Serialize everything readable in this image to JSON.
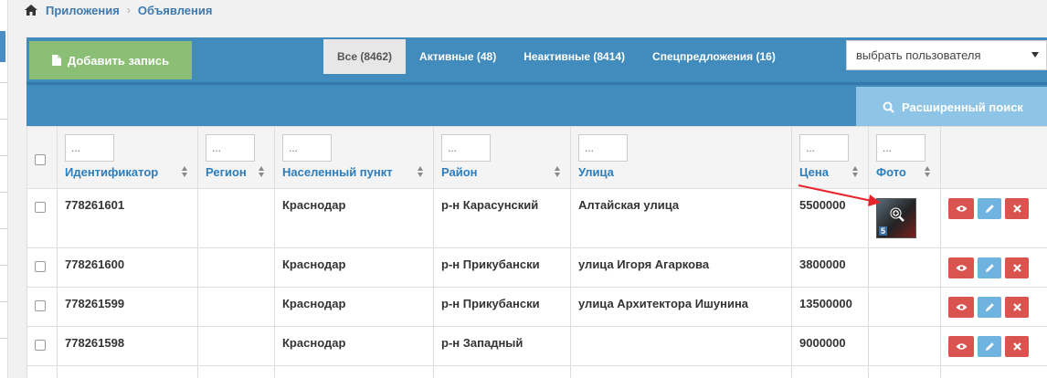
{
  "breadcrumb": {
    "home_icon": "home-icon",
    "items": [
      "Приложения",
      "Объявления"
    ]
  },
  "toolbar": {
    "add_button": "Добавить запись",
    "tabs": [
      {
        "label": "Все (8462)",
        "active": true
      },
      {
        "label": "Активные (48)",
        "active": false
      },
      {
        "label": "Неактивные (8414)",
        "active": false
      },
      {
        "label": "Спецпредложения (16)",
        "active": false
      }
    ],
    "user_select": {
      "value": "выбрать пользователя"
    }
  },
  "search": {
    "button": "Расширенный поиск"
  },
  "table": {
    "filter_placeholder": "...",
    "columns": [
      "Идентификатор",
      "Регион",
      "Населенный пункт",
      "Район",
      "Улица",
      "Цена",
      "Фото"
    ],
    "rows": [
      {
        "id": "778261601",
        "region": "",
        "city": "Краснодар",
        "district": "р-н Карасунский",
        "street": "Алтайская улица",
        "price": "5500000",
        "photo": {
          "count": "5"
        }
      },
      {
        "id": "778261600",
        "region": "",
        "city": "Краснодар",
        "district": "р-н Прикубански",
        "street": "улица Игоря Агаркова",
        "price": "3800000",
        "photo": null
      },
      {
        "id": "778261599",
        "region": "",
        "city": "Краснодар",
        "district": "р-н Прикубански",
        "street": "улица Архитектора Ишунина",
        "price": "13500000",
        "photo": null
      },
      {
        "id": "778261598",
        "region": "",
        "city": "Краснодар",
        "district": "р-н Западный",
        "street": "",
        "price": "9000000",
        "photo": null
      }
    ]
  },
  "colors": {
    "toolbar_bg": "#428bbd",
    "add_button_bg": "#8bbf75",
    "search_button_bg": "#8ec4e6",
    "column_label": "#2b7dbc",
    "annotation_arrow": "#e8242b"
  }
}
